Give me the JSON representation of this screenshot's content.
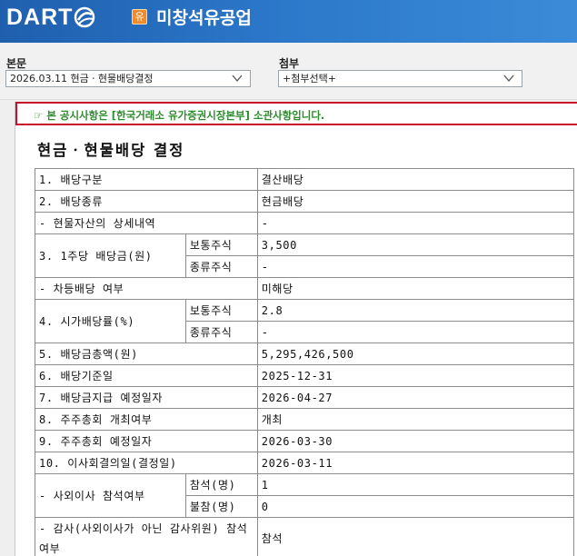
{
  "header": {
    "logo_text": "DART",
    "market_badge": "유",
    "company_name": "미창석유공업",
    "colors": {
      "header_bg": "#2b76c8",
      "badge": "#f08a2c"
    }
  },
  "selectors": {
    "body_label": "본문",
    "body_value": "2026.03.11  현금ㆍ현물배당결정",
    "attach_label": "첨부",
    "attach_value": "+첨부선택+"
  },
  "notice": {
    "text": "☞ 본 공시사항은 [한국거래소 유가증권시장본부] 소관사항입니다.",
    "border_color": "#c8112b",
    "text_color": "#2e8b2e"
  },
  "document": {
    "title": "현금ㆍ현물배당 결정",
    "rows": {
      "r1": {
        "label": "1. 배당구분",
        "value": "결산배당"
      },
      "r2": {
        "label": "2. 배당종류",
        "value": "현금배당"
      },
      "r3": {
        "label": "- 현물자산의 상세내역",
        "value": "-"
      },
      "r4": {
        "label": "3. 1주당 배당금(원)",
        "sub1": "보통주식",
        "val1": "3,500",
        "sub2": "종류주식",
        "val2": "-"
      },
      "r5": {
        "label": "- 차등배당 여부",
        "value": "미해당"
      },
      "r6": {
        "label": "4. 시가배당률(%)",
        "sub1": "보통주식",
        "val1": "2.8",
        "sub2": "종류주식",
        "val2": "-"
      },
      "r7": {
        "label": "5. 배당금총액(원)",
        "value": "5,295,426,500"
      },
      "r8": {
        "label": "6. 배당기준일",
        "value": "2025-12-31"
      },
      "r9": {
        "label": "7. 배당금지급 예정일자",
        "value": "2026-04-27"
      },
      "r10": {
        "label": "8. 주주총회 개최여부",
        "value": "개최"
      },
      "r11": {
        "label": "9. 주주총회 예정일자",
        "value": "2026-03-30"
      },
      "r12": {
        "label": "10. 이사회결의일(결정일)",
        "value": "2026-03-11"
      },
      "r13": {
        "label": "- 사외이사 참석여부",
        "sub1": "참석(명)",
        "val1": "1",
        "sub2": "불참(명)",
        "val2": "0"
      },
      "r14": {
        "label": "- 감사(사외이사가 아닌 감사위원) 참석여부",
        "value": "참석"
      }
    }
  }
}
